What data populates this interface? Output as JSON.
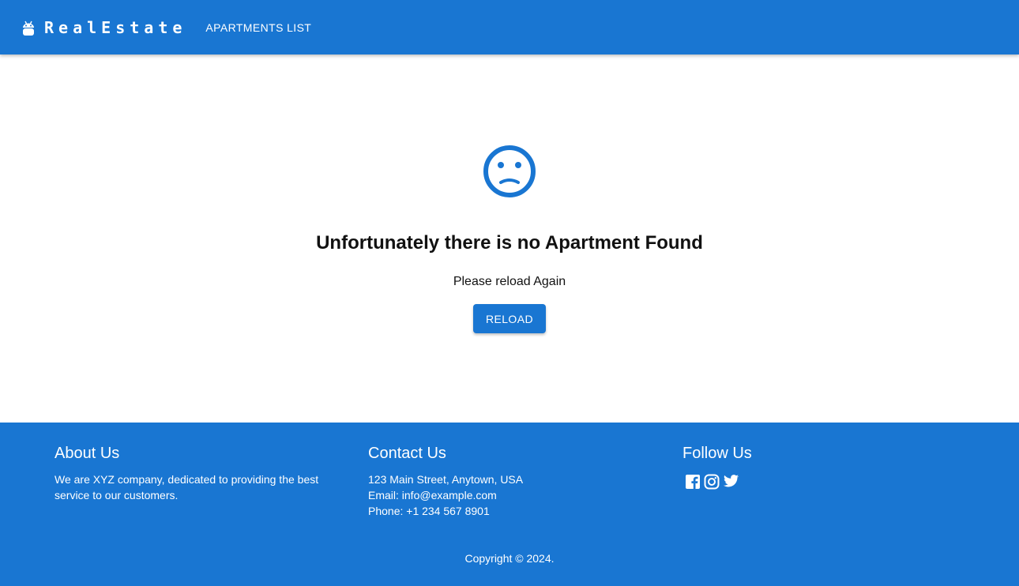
{
  "header": {
    "brand": "RealEstate",
    "nav_link": "APARTMENTS LIST"
  },
  "empty_state": {
    "icon": "sad-face-icon",
    "title": "Unfortunately there is no Apartment Found",
    "subtitle": "Please reload Again",
    "button_label": "RELOAD"
  },
  "footer": {
    "about": {
      "heading": "About Us",
      "text": "We are XYZ company, dedicated to providing the best service to our customers."
    },
    "contact": {
      "heading": "Contact Us",
      "address": "123 Main Street, Anytown, USA",
      "email": "Email: info@example.com",
      "phone": "Phone: +1 234 567 8901"
    },
    "follow": {
      "heading": "Follow Us",
      "icons": [
        "facebook-icon",
        "instagram-icon",
        "twitter-icon"
      ]
    },
    "copyright": "Copyright © 2024."
  },
  "colors": {
    "primary": "#1976d2",
    "text": "#111111",
    "on_primary": "#ffffff"
  }
}
